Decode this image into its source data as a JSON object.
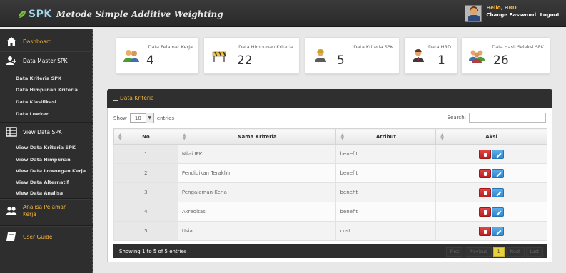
{
  "header": {
    "logo_spk": "SPK",
    "logo_subtitle": "Metode Simple Additive Weighting",
    "greeting": "Hello, HRD",
    "change_password": "Change Password",
    "logout": "Logout"
  },
  "sidebar": {
    "dashboard": "Dashboard",
    "master": "Data Master SPK",
    "master_items": [
      "Data Kriteria SPK",
      "Data Himpunan Kriteria",
      "Data Klasifikasi",
      "Data Lowker"
    ],
    "view": "View Data SPK",
    "view_items": [
      "View Data Kriteria SPK",
      "View Data Himpunan",
      "View Data Lowongan Kerja",
      "View Data Alternatif",
      "View Data Analisa"
    ],
    "analisa_line1": "Analisa Pelamar",
    "analisa_line2": "Kerja",
    "guide": "User Guide"
  },
  "stats": [
    {
      "label": "Data Pelamar Kerja",
      "value": "4"
    },
    {
      "label": "Data Himpunan Kriteria",
      "value": "22"
    },
    {
      "label": "Data Kriteria SPK",
      "value": "5"
    },
    {
      "label": "Data HRD",
      "value": "1"
    },
    {
      "label": "Data Hasil Seleksi SPK",
      "value": "26"
    }
  ],
  "panel": {
    "title": "Data Kriteria",
    "show_label": "Show",
    "entries_value": "10",
    "entries_label": "entries",
    "search_label": "Search:",
    "columns": [
      "No",
      "Nama Kriteria",
      "Atribut",
      "Aksi"
    ],
    "rows": [
      {
        "no": "1",
        "nama": "Nilai IPK",
        "atribut": "benefit"
      },
      {
        "no": "2",
        "nama": "Pendidikan Terakhir",
        "atribut": "benefit"
      },
      {
        "no": "3",
        "nama": "Pengalaman Kerja",
        "atribut": "benefit"
      },
      {
        "no": "4",
        "nama": "Akreditasi",
        "atribut": "benefit"
      },
      {
        "no": "5",
        "nama": "Usia",
        "atribut": "cost"
      }
    ],
    "footer_info": "Showing 1 to 5 of 5 entries",
    "pager": {
      "first": "First",
      "previous": "Previous",
      "current": "1",
      "next": "Next",
      "last": "Last"
    }
  },
  "colors": {
    "accent": "#f3b33d",
    "topbar": "#2f2f2f",
    "delete": "#d33a3a",
    "edit": "#3d95d8"
  }
}
